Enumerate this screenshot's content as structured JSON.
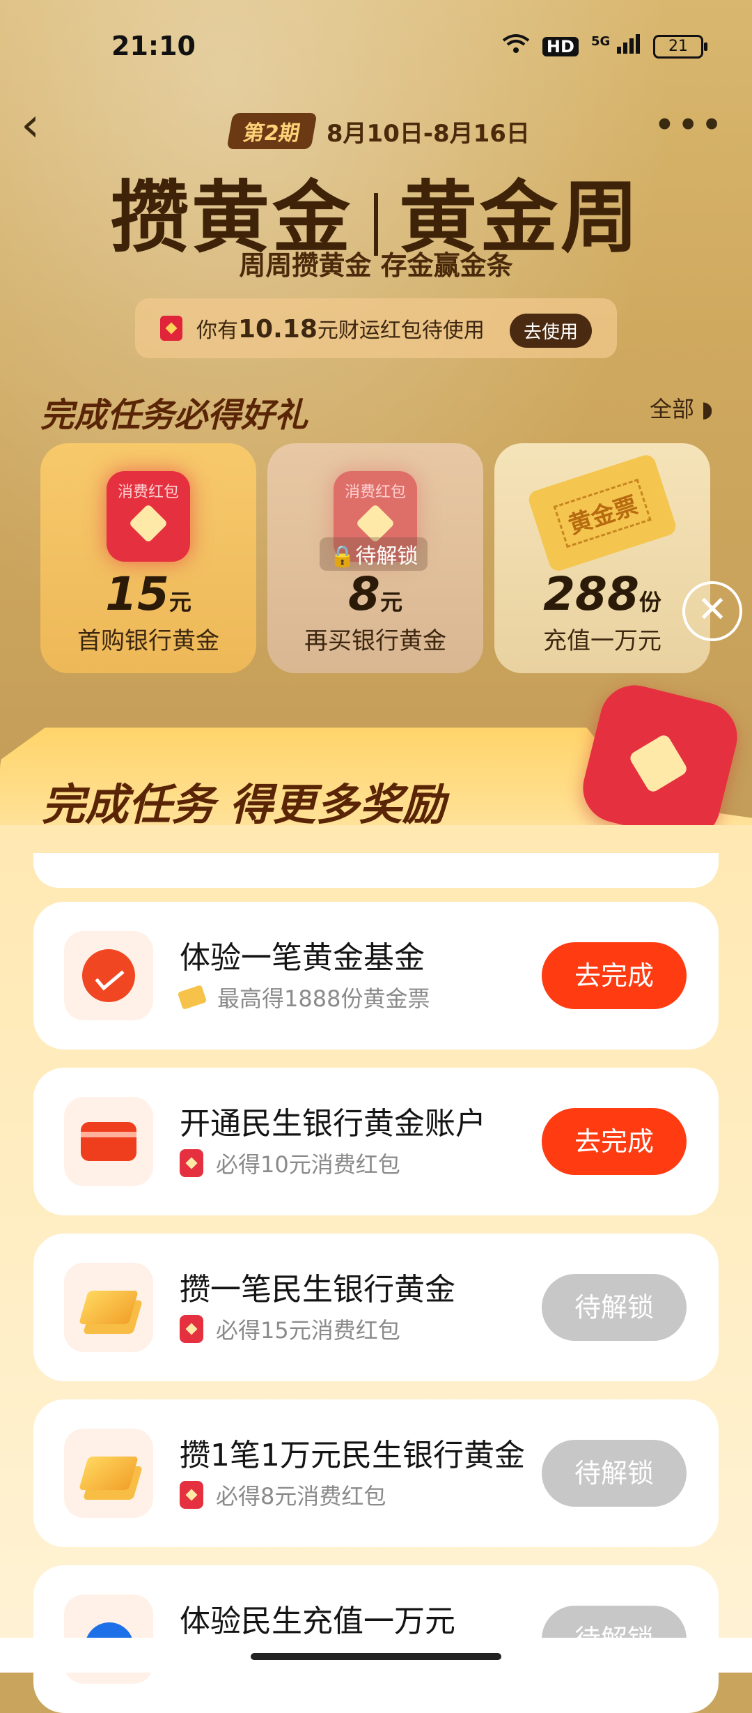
{
  "status_bar": {
    "time": "21:10",
    "hd": "HD",
    "signal": "5G",
    "battery": "21"
  },
  "nav": {
    "back_icon": "‹",
    "more_icon": "•••"
  },
  "header": {
    "period_badge": "第2期",
    "period_dates": "8月10日-8月16日",
    "title_left": "攒黄金",
    "title_right": "黄金周",
    "subtitle": "周周攒黄金 存金赢金条"
  },
  "redbag_bar": {
    "prefix": "你有",
    "amount": "10.18",
    "suffix": "元财运红包待使用",
    "button": "去使用"
  },
  "gifts_section": {
    "title": "完成任务必得好礼",
    "all_link": "全部",
    "items": [
      {
        "bag_label": "消费红包",
        "amount": "15",
        "unit": "元",
        "desc": "首购银行黄金"
      },
      {
        "bag_label": "消费红包",
        "lock_text": "待解锁",
        "amount": "8",
        "unit": "元",
        "desc": "再买银行黄金"
      },
      {
        "ticket_label": "黄金票",
        "amount": "288",
        "unit": "份",
        "desc": "充值一万元"
      }
    ]
  },
  "close_icon": "✕",
  "sheet": {
    "title": "完成任务 得更多奖励",
    "tasks": [
      {
        "title": "体验一笔黄金基金",
        "subtitle": "最高得1888份黄金票",
        "button": "去完成",
        "state": "active"
      },
      {
        "title": "开通民生银行黄金账户",
        "subtitle": "必得10元消费红包",
        "button": "去完成",
        "state": "active"
      },
      {
        "title": "攒一笔民生银行黄金",
        "subtitle": "必得15元消费红包",
        "button": "待解锁",
        "state": "locked"
      },
      {
        "title": "攒1笔1万元民生银行黄金",
        "subtitle": "必得8元消费红包",
        "button": "待解锁",
        "state": "locked"
      },
      {
        "title": "体验民生充值一万元",
        "subtitle": "",
        "button": "待解锁",
        "state": "locked"
      }
    ]
  },
  "colors": {
    "accent": "#ff3b12",
    "locked": "#c7c7c7",
    "brown": "#3e2308"
  }
}
